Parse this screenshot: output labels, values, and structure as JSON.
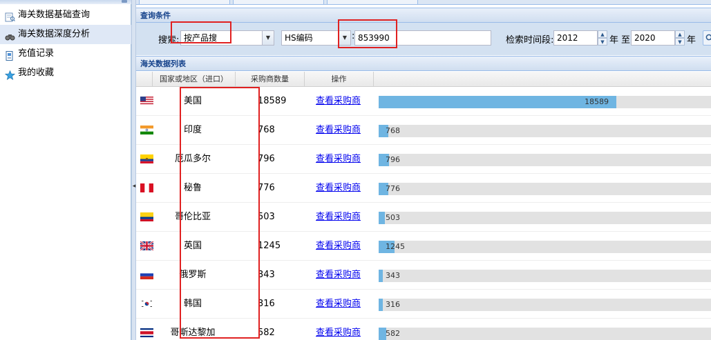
{
  "sidebar": {
    "items": [
      {
        "label": "海关数据基础查询",
        "icon": "document-search-icon",
        "active": false
      },
      {
        "label": "海关数据深度分析",
        "icon": "binoculars-icon",
        "active": true
      },
      {
        "label": "充值记录",
        "icon": "receipt-icon",
        "active": false
      },
      {
        "label": "我的收藏",
        "icon": "star-icon",
        "active": false
      }
    ]
  },
  "query": {
    "header": "查询条件",
    "search_label": "搜索:",
    "search_mode": "按产品搜",
    "code_type": "HS编码",
    "code_separator": ":",
    "code_value": "853990",
    "period_label": "检索时间段:",
    "year_from": "2012",
    "year_unit_1": "年",
    "to_label": "至",
    "year_to": "2020",
    "year_unit_2": "年"
  },
  "list": {
    "header": "海关数据列表",
    "columns": [
      "国家或地区（进口）",
      "采购商数量",
      "操作"
    ],
    "action_label": "查看采购商",
    "max_value": 18589,
    "rows": [
      {
        "country": "美国",
        "count": "18589",
        "value": 18589,
        "flag": "us-flag-icon"
      },
      {
        "country": "印度",
        "count": "768",
        "value": 768,
        "flag": "india-flag-icon"
      },
      {
        "country": "厄瓜多尔",
        "count": "796",
        "value": 796,
        "flag": "ecuador-flag-icon"
      },
      {
        "country": "秘鲁",
        "count": "776",
        "value": 776,
        "flag": "peru-flag-icon"
      },
      {
        "country": "哥伦比亚",
        "count": "503",
        "value": 503,
        "flag": "colombia-flag-icon"
      },
      {
        "country": "英国",
        "count": "1245",
        "value": 1245,
        "flag": "uk-flag-icon"
      },
      {
        "country": "俄罗斯",
        "count": "343",
        "value": 343,
        "flag": "russia-flag-icon"
      },
      {
        "country": "韩国",
        "count": "316",
        "value": 316,
        "flag": "korea-flag-icon"
      },
      {
        "country": "哥斯达黎加",
        "count": "582",
        "value": 582,
        "flag": "costa-rica-flag-icon"
      }
    ]
  },
  "colors": {
    "bar_fill": "#6fb5e2",
    "bar_track": "#e2e2e2",
    "highlight": "#e02020",
    "link": "#0000ee"
  }
}
